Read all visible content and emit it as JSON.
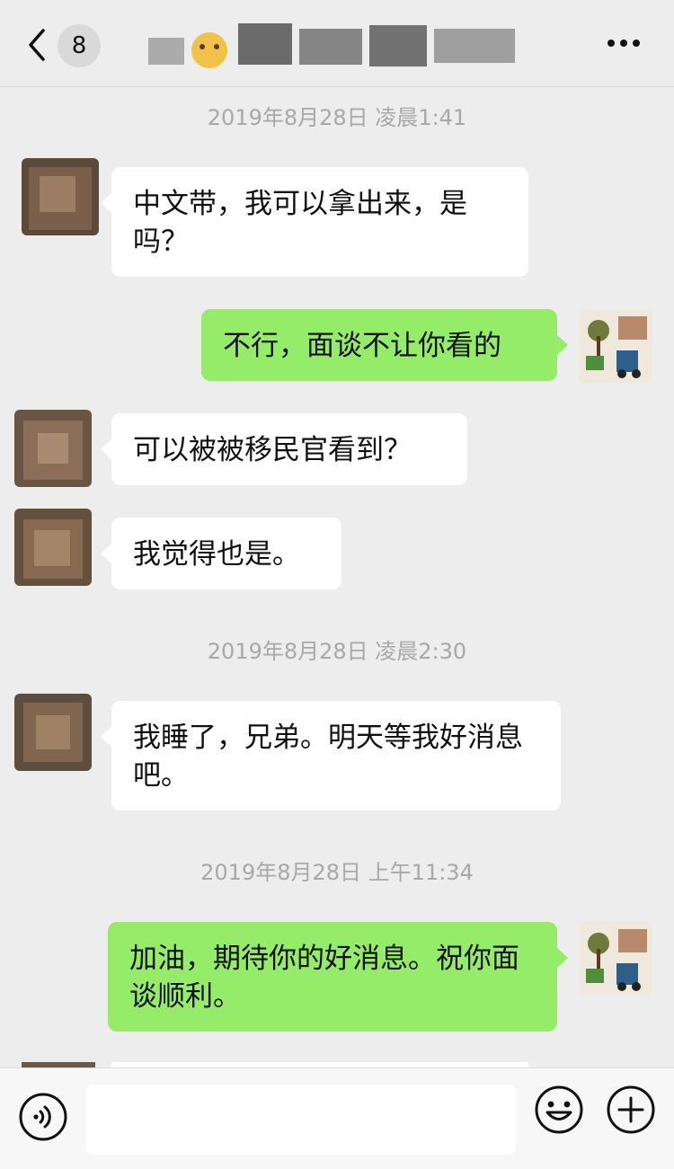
{
  "header": {
    "unread_count": "8",
    "chat_title": "",
    "back_icon": "chevron-left-icon",
    "more_icon": "more-dots-icon"
  },
  "messages": [
    {
      "type": "timestamp",
      "text": "2019年8月28日 凌晨1:41"
    },
    {
      "type": "message",
      "side": "left",
      "text": "中文带，我可以拿出来，是吗？"
    },
    {
      "type": "message",
      "side": "right",
      "text": "不行，面谈不让你看的"
    },
    {
      "type": "message",
      "side": "left",
      "text": "可以被被移民官看到？"
    },
    {
      "type": "message",
      "side": "left",
      "text": "我觉得也是。"
    },
    {
      "type": "timestamp",
      "text": "2019年8月28日 凌晨2:30"
    },
    {
      "type": "message",
      "side": "left",
      "text": "我睡了，兄弟。明天等我好消息吧。"
    },
    {
      "type": "timestamp",
      "text": "2019年8月28日 上午11:34"
    },
    {
      "type": "message",
      "side": "right",
      "text": "加油，期待你的好消息。祝你面谈顺利。"
    }
  ],
  "input_bar": {
    "placeholder": "",
    "voice_icon": "voice-icon",
    "emoji_icon": "emoji-icon",
    "plus_icon": "plus-icon"
  },
  "colors": {
    "background": "#ededed",
    "bubble_mine": "#95ec69",
    "bubble_theirs": "#ffffff",
    "timestamp_text": "#a8a8a8"
  }
}
